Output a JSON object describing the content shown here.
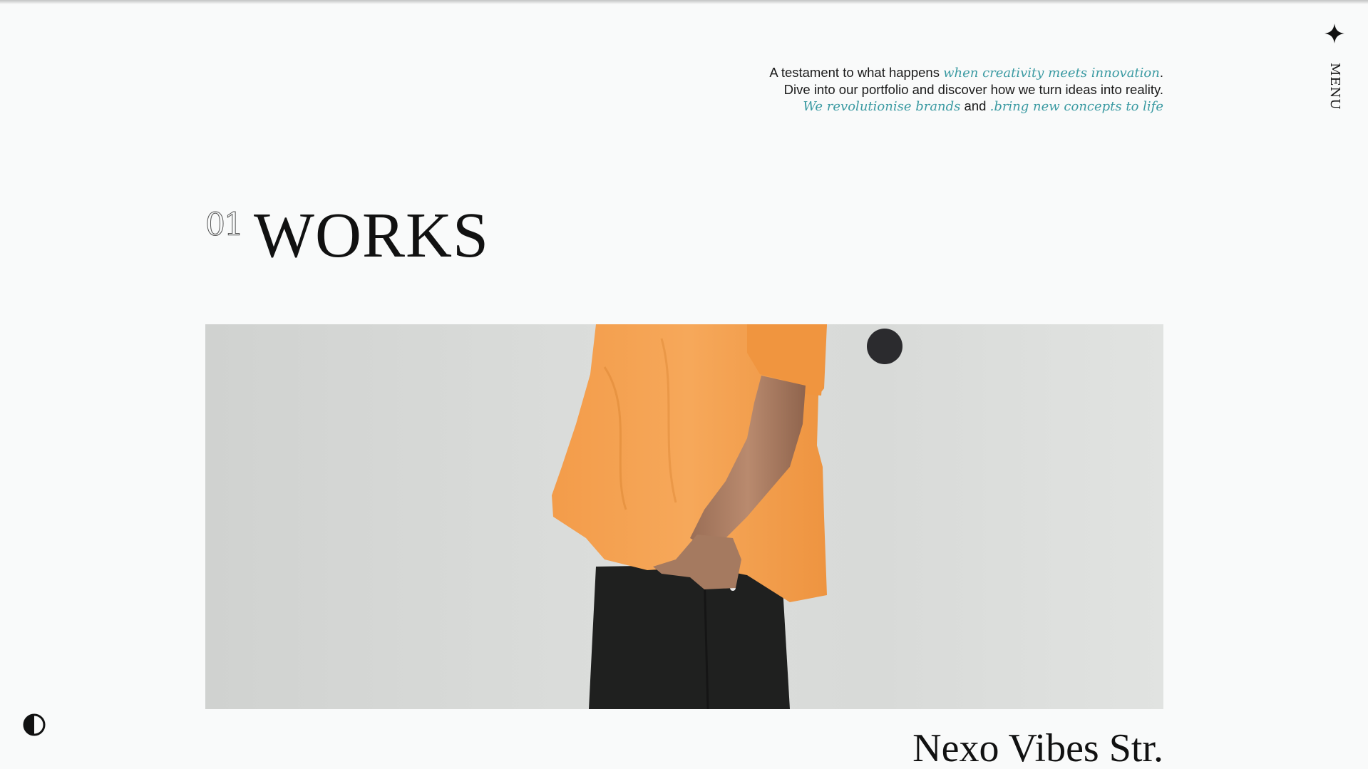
{
  "intro": {
    "text_1": "A testament to what happens ",
    "em_1": "when creativity meets innovation",
    "text_2": ". Dive into our portfolio and discover how we turn ideas into reality. ",
    "em_2": "We revolutionise brands",
    "text_3": " and ",
    "em_3": "bring new concepts to life",
    "trail": "."
  },
  "menu": {
    "label": "MENU",
    "icon": "plus-icon"
  },
  "section": {
    "number": "01",
    "title": "WORKS"
  },
  "project": {
    "title": "Nexo Vibes Str.",
    "image": "photo of person in orange t-shirt and black trousers, hand in pocket"
  },
  "theme_toggle": {
    "icon": "half-circle-contrast-icon"
  },
  "colors": {
    "background": "#f9fafa",
    "accent": "#3a9aa2",
    "text": "#111111",
    "shirt": "#f29a45",
    "pants": "#1f201f",
    "cursor": "#2b2b2e"
  }
}
